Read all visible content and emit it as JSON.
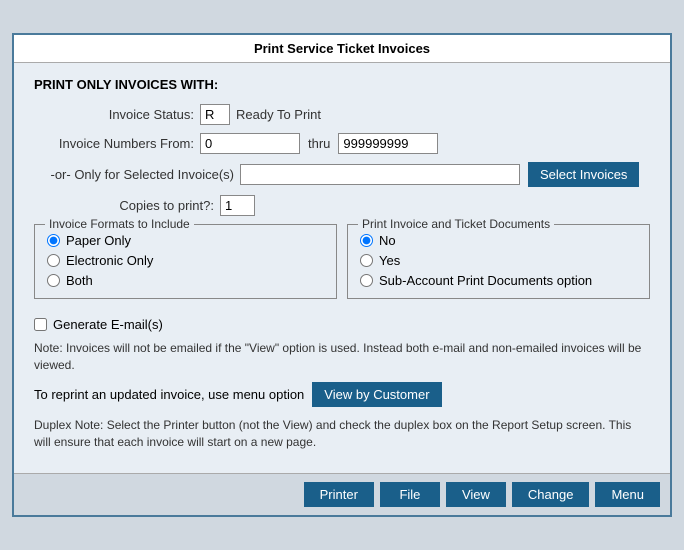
{
  "window": {
    "title": "Print Service Ticket Invoices"
  },
  "header": {
    "label": "PRINT ONLY INVOICES WITH:"
  },
  "form": {
    "invoice_status_label": "Invoice Status:",
    "invoice_status_value": "R",
    "invoice_status_desc": "Ready To Print",
    "invoice_numbers_label": "Invoice Numbers From:",
    "invoice_from_value": "0",
    "thru_label": "thru",
    "invoice_thru_value": "999999999",
    "selected_label": "-or-  Only for Selected Invoice(s)",
    "selected_value": "",
    "select_invoices_btn": "Select Invoices",
    "copies_label": "Copies to print?:",
    "copies_value": "1"
  },
  "invoice_formats": {
    "title": "Invoice Formats to Include",
    "options": [
      {
        "label": "Paper Only",
        "checked": true
      },
      {
        "label": "Electronic Only",
        "checked": false
      },
      {
        "label": "Both",
        "checked": false
      }
    ]
  },
  "print_documents": {
    "title": "Print Invoice and Ticket Documents",
    "options": [
      {
        "label": "No",
        "checked": true
      },
      {
        "label": "Yes",
        "checked": false
      },
      {
        "label": "Sub-Account Print Documents option",
        "checked": false
      }
    ]
  },
  "generate_emails": {
    "label": "Generate E-mail(s)",
    "checked": false
  },
  "note": {
    "text": "Note: Invoices will not be emailed if the \"View\" option is used.  Instead both e-mail and non-emailed invoices will be viewed."
  },
  "reprint": {
    "label": "To reprint an updated invoice, use menu option",
    "button": "View by Customer"
  },
  "duplex_note": {
    "text": "Duplex Note: Select the Printer button (not the View) and check the duplex box on the Report Setup screen.  This will ensure that each invoice will start on a new page."
  },
  "bottom_buttons": [
    {
      "label": "Printer",
      "name": "printer-button"
    },
    {
      "label": "File",
      "name": "file-button"
    },
    {
      "label": "View",
      "name": "view-button"
    },
    {
      "label": "Change",
      "name": "change-button"
    },
    {
      "label": "Menu",
      "name": "menu-button"
    }
  ]
}
